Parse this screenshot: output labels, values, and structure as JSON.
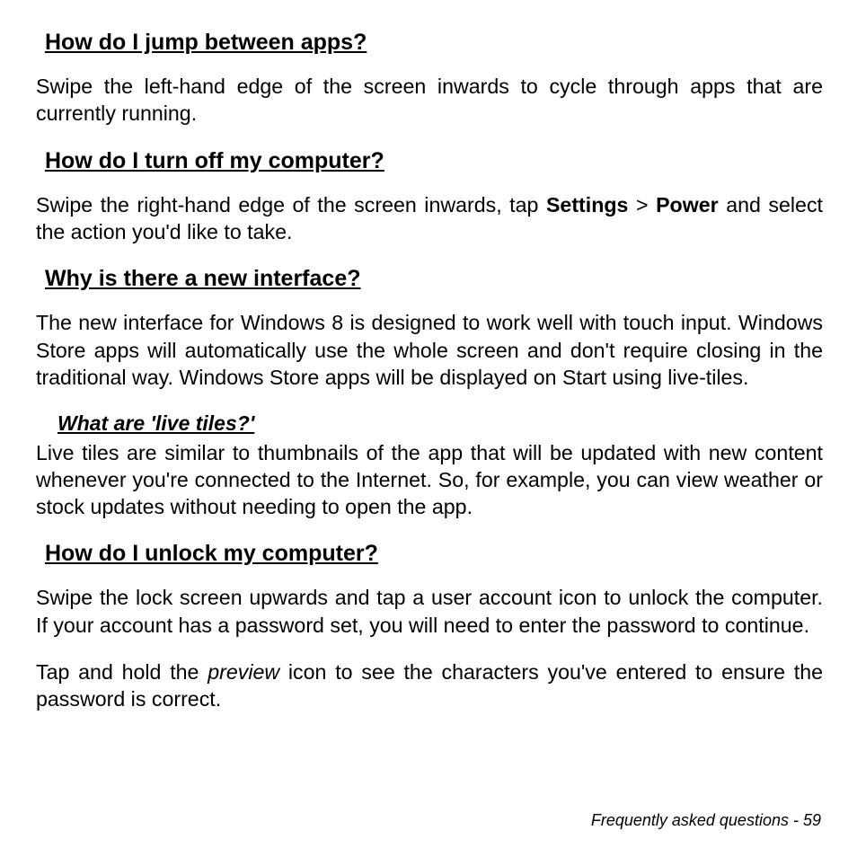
{
  "q1": {
    "title": "How do I jump between apps?",
    "body": "Swipe the left-hand edge of the screen inwards to cycle through apps that are currently running."
  },
  "q2": {
    "title": "How do I turn off my computer?",
    "body_pre": "Swipe the right-hand edge of the screen inwards, tap ",
    "settings": "Settings",
    "gt": " > ",
    "power": "Power",
    "body_post": " and select the action you'd like to take."
  },
  "q3": {
    "title": "Why is there a new interface?",
    "body": "The new interface for Windows 8 is designed to work well with touch input. Windows Store apps will automatically use the whole screen and don't require closing in the traditional way. Windows Store apps will be displayed on Start using live-tiles."
  },
  "sub": {
    "title": "What are 'live tiles?'",
    "body": "Live tiles are similar to thumbnails of the app that will be updated with new content whenever you're connected to the Internet. So, for example, you can view weather or stock updates without needing to open the app."
  },
  "q4": {
    "title": "How do I unlock my computer?",
    "body1": "Swipe the lock screen upwards and tap a user account icon to unlock the computer. If your account has a password set, you will need to enter the password to continue.",
    "body2_pre": "Tap and hold the ",
    "preview": "preview",
    "body2_post": " icon to see the characters you've entered to ensure the password is correct."
  },
  "footer": {
    "label": "Frequently asked questions -  ",
    "page": "59"
  }
}
